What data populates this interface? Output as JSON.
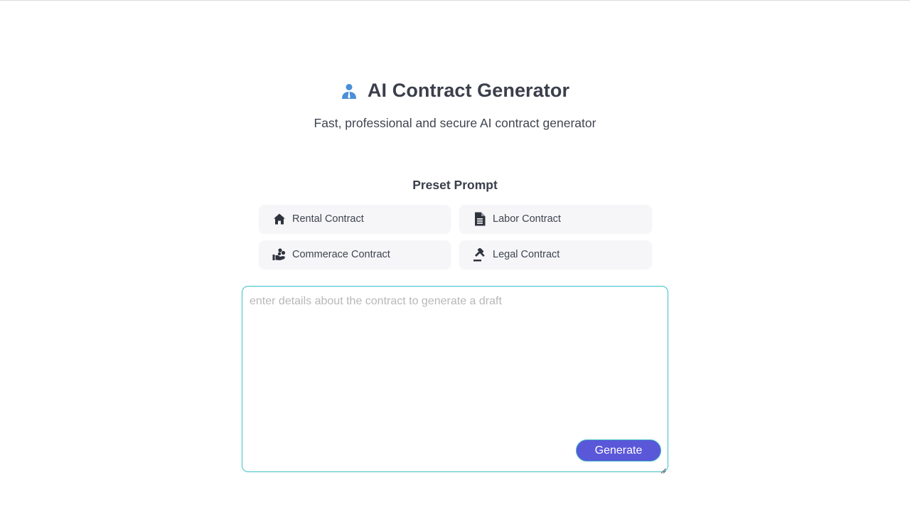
{
  "header": {
    "title": "AI Contract Generator",
    "subtitle": "Fast, professional and secure AI contract generator",
    "logo_icon": "business-person-icon",
    "logo_color": "#4a8fd8"
  },
  "presets": {
    "heading": "Preset Prompt",
    "items": [
      {
        "label": "Rental Contract",
        "icon": "house-icon"
      },
      {
        "label": "Labor Contract",
        "icon": "document-icon"
      },
      {
        "label": "Commerace Contract",
        "icon": "hand-coins-icon"
      },
      {
        "label": "Legal Contract",
        "icon": "gavel-icon"
      }
    ]
  },
  "prompt": {
    "placeholder": "enter details about the contract to generate a draft",
    "value": ""
  },
  "actions": {
    "generate_label": "Generate"
  },
  "colors": {
    "accent": "#5b57d9",
    "border_focus": "#3cc0c8",
    "card_bg": "#f6f6f8",
    "text": "#3f4450"
  }
}
